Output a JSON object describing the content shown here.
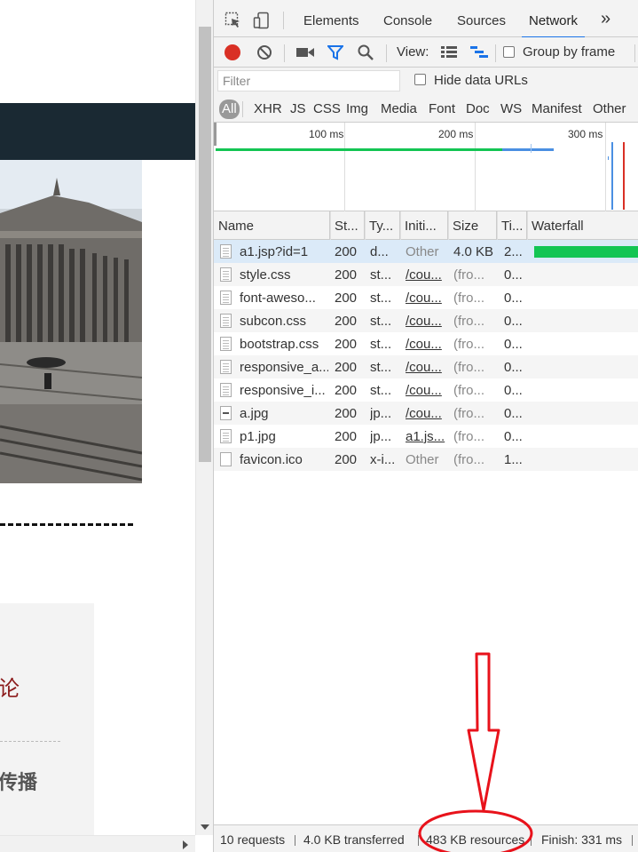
{
  "webpage": {
    "category_1": "论",
    "category_2": "传播"
  },
  "devtools": {
    "tabs": [
      "Elements",
      "Console",
      "Sources",
      "Network"
    ],
    "active_tab": "Network",
    "more_tabs_icon": "»",
    "toolbar": {
      "view_label": "View:",
      "group_by_frame_label": "Group by frame",
      "group_by_frame_checked": false
    },
    "filter": {
      "placeholder": "Filter",
      "hide_data_urls_label": "Hide data URLs",
      "hide_data_urls_checked": false
    },
    "type_filters": [
      "All",
      "XHR",
      "JS",
      "CSS",
      "Img",
      "Media",
      "Font",
      "Doc",
      "WS",
      "Manifest",
      "Other"
    ],
    "active_type_filter": "All",
    "overview": {
      "tick_labels": [
        "100 ms",
        "200 ms",
        "300 ms"
      ]
    },
    "columns": [
      "Name",
      "St...",
      "Ty...",
      "Initi...",
      "Size",
      "Ti...",
      "Waterfall"
    ],
    "requests": [
      {
        "name": "a1.jsp?id=1",
        "status": "200",
        "type": "d...",
        "initiator": "Other",
        "size": "4.0 KB",
        "time": "2...",
        "icon": "doc"
      },
      {
        "name": "style.css",
        "status": "200",
        "type": "st...",
        "initiator": "/cou...",
        "size": "(fro...",
        "time": "0...",
        "icon": "doc"
      },
      {
        "name": "font-aweso...",
        "status": "200",
        "type": "st...",
        "initiator": "/cou...",
        "size": "(fro...",
        "time": "0...",
        "icon": "doc"
      },
      {
        "name": "subcon.css",
        "status": "200",
        "type": "st...",
        "initiator": "/cou...",
        "size": "(fro...",
        "time": "0...",
        "icon": "doc"
      },
      {
        "name": "bootstrap.css",
        "status": "200",
        "type": "st...",
        "initiator": "/cou...",
        "size": "(fro...",
        "time": "0...",
        "icon": "doc"
      },
      {
        "name": "responsive_a...",
        "status": "200",
        "type": "st...",
        "initiator": "/cou...",
        "size": "(fro...",
        "time": "0...",
        "icon": "doc"
      },
      {
        "name": "responsive_i...",
        "status": "200",
        "type": "st...",
        "initiator": "/cou...",
        "size": "(fro...",
        "time": "0...",
        "icon": "doc"
      },
      {
        "name": "a.jpg",
        "status": "200",
        "type": "jp...",
        "initiator": "/cou...",
        "size": "(fro...",
        "time": "0...",
        "icon": "img"
      },
      {
        "name": "p1.jpg",
        "status": "200",
        "type": "jp...",
        "initiator": "a1.js...",
        "size": "(fro...",
        "time": "0...",
        "icon": "doc"
      },
      {
        "name": "favicon.ico",
        "status": "200",
        "type": "x-i...",
        "initiator": "Other",
        "size": "(fro...",
        "time": "1...",
        "icon": "blank"
      }
    ],
    "status": {
      "requests": "10 requests",
      "transferred": "4.0 KB transferred",
      "resources": "483 KB resources",
      "finish": "Finish: 331 ms"
    },
    "colors": {
      "accent": "#1a73e8",
      "record": "#d93025",
      "waterfall": "#13c553",
      "annotation": "#e8121b"
    }
  }
}
